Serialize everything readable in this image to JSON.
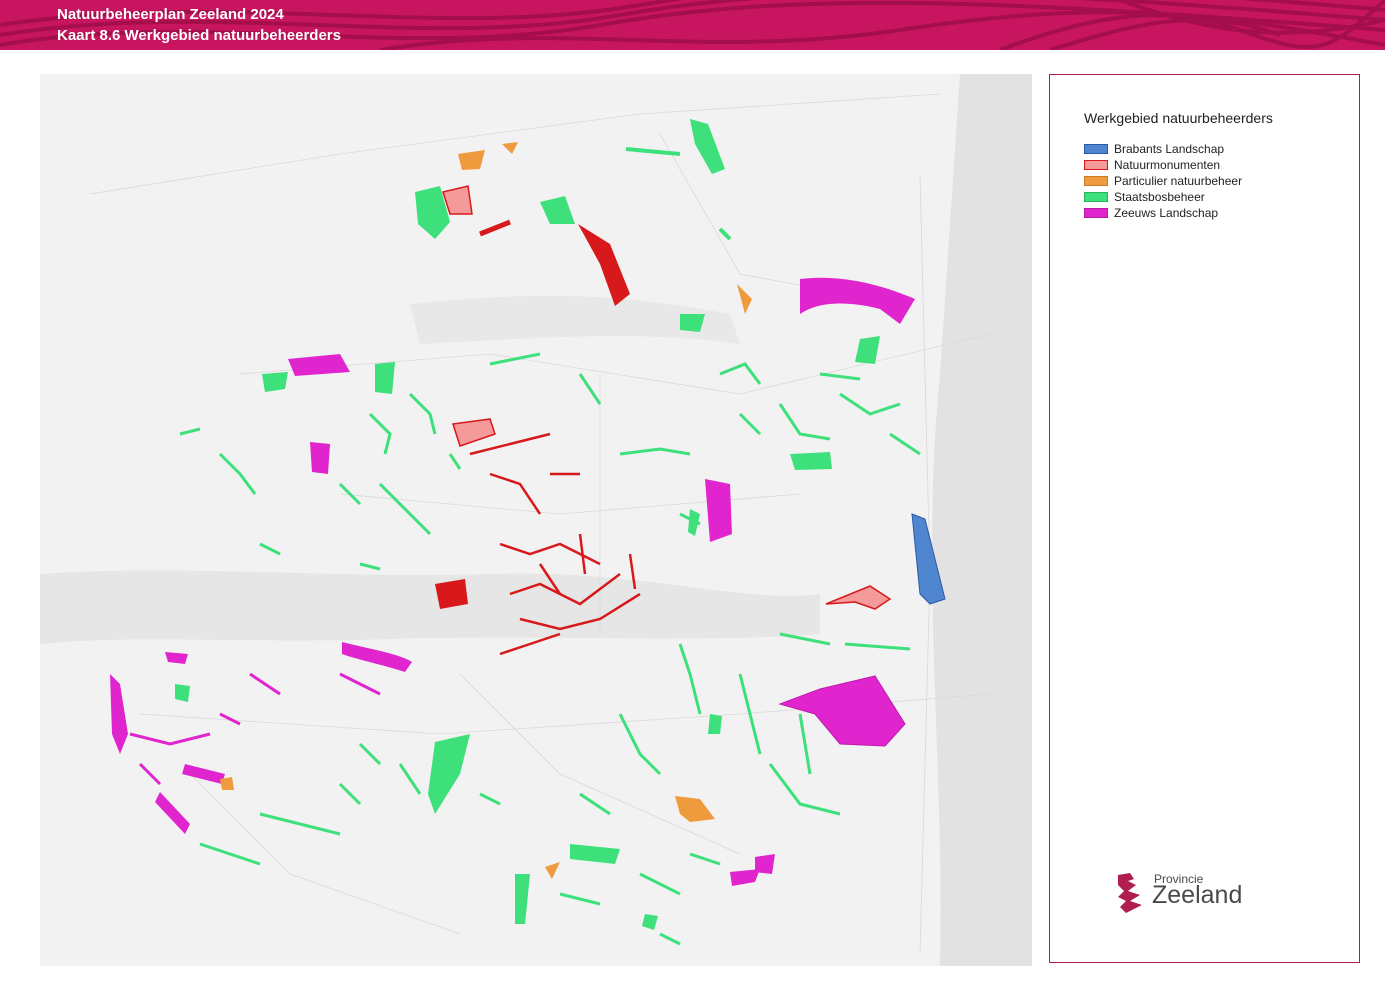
{
  "header": {
    "title_line1": "Natuurbeheerplan Zeeland 2024",
    "title_line2": "Kaart 8.6 Werkgebied natuurbeheerders",
    "banner_color": "#c8155f"
  },
  "legend": {
    "title": "Werkgebied natuurbeheerders",
    "items": [
      {
        "label": "Brabants Landschap",
        "color": "#4f86cf"
      },
      {
        "label": "Natuurmonumenten",
        "color": "#f59a9a"
      },
      {
        "label": "Particulier natuurbeheer",
        "color": "#f09a3e"
      },
      {
        "label": "Staatsbosbeheer",
        "color": "#3de07a"
      },
      {
        "label": "Zeeuws Landschap",
        "color": "#e025cf"
      }
    ]
  },
  "logo": {
    "line1": "Provincie",
    "line2": "Zeeland",
    "color": "#b01d50"
  },
  "map": {
    "background": "#f1f1f1",
    "natuurmonumenten_line": "#d7191c"
  }
}
